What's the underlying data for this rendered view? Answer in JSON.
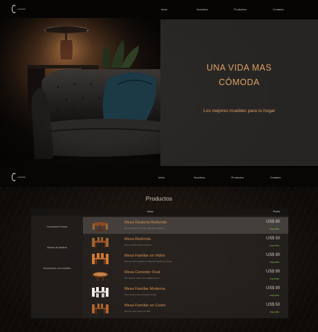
{
  "brand": {
    "logo_text": "comodo"
  },
  "nav": {
    "links": [
      "Inicio",
      "Nosotros",
      "Productos",
      "Contacto"
    ]
  },
  "hero": {
    "title_line1": "UNA VIDA MAS",
    "title_line2": "CÓMODA",
    "subtitle": "Los mejores muebles para tu hogar"
  },
  "products": {
    "title": "Productos",
    "columns": {
      "name": "Mesa",
      "price": "Precio"
    },
    "categories": [
      "Comedores Rosas",
      "Mesas de Madera",
      "Decoración con muebles"
    ],
    "items": [
      {
        "name": "Mesa Giratoria Redonda",
        "desc": "Mesa de madera con vidrio, ideal para comedores",
        "price": "US$ 90",
        "stock": "disponible"
      },
      {
        "name": "Mesa Redonda",
        "desc": "Mesa de madera para 4 personas",
        "price": "US$ 50",
        "stock": "disponible"
      },
      {
        "name": "Mesa Familiar en Vidrio",
        "desc": "Mesa de vidrio templado con sillas para familias numerosas",
        "price": "US$ 90",
        "stock": "disponible"
      },
      {
        "name": "Mesa Comedor Oval",
        "desc": "Mesa oval de madera con acabado premium",
        "price": "US$ 90",
        "stock": "disponible"
      },
      {
        "name": "Mesa Familiar Moderna",
        "desc": "Mesa moderna para comedores amplios",
        "price": "US$ 90",
        "stock": "disponible"
      },
      {
        "name": "Mesa Familiar en Cedro",
        "desc": "Mesa de cedro macizo con sillas",
        "price": "US$ 50",
        "stock": "disponible"
      }
    ]
  }
}
